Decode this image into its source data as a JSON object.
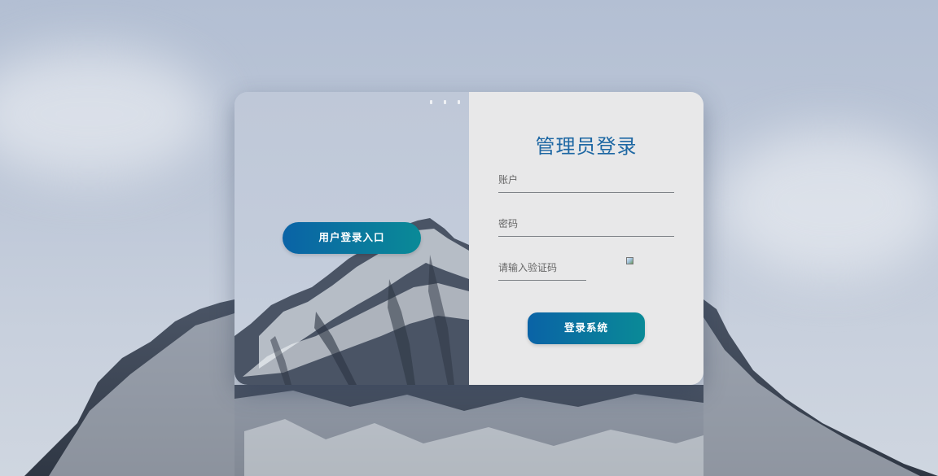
{
  "left_panel": {
    "entry_button_label": "用户登录入口"
  },
  "login_form": {
    "title": "管理员登录",
    "account_placeholder": "账户",
    "password_placeholder": "密码",
    "captcha_placeholder": "请输入验证码",
    "submit_label": "登录系统"
  },
  "colors": {
    "title": "#1d67a3",
    "button_gradient_start": "#0a63a6",
    "button_gradient_end": "#0a8a97",
    "form_panel_bg": "#e8e8e9"
  },
  "icons": {
    "captcha": "broken-image-icon"
  }
}
